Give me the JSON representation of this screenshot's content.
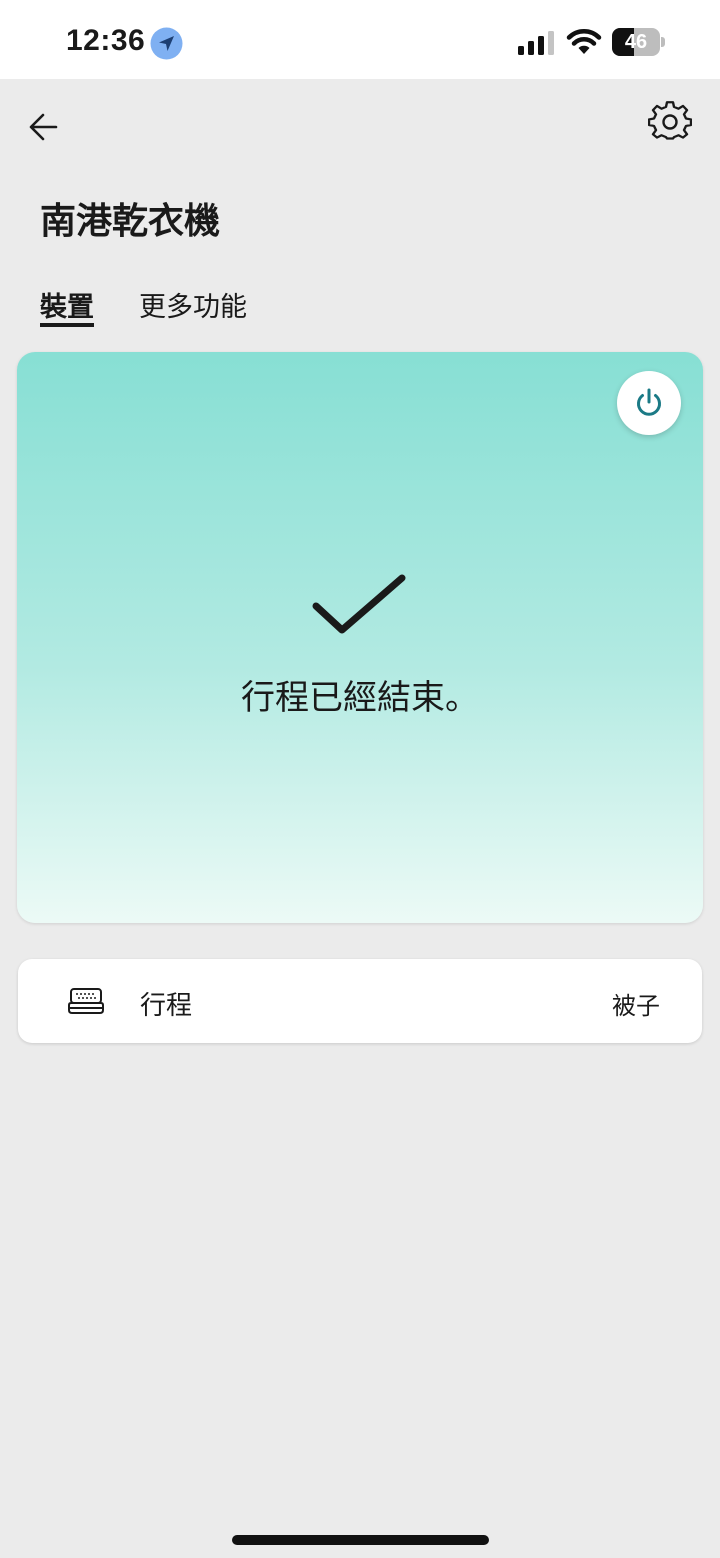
{
  "status_bar": {
    "time": "12:36",
    "battery_percent": 46,
    "battery_label": "46"
  },
  "header": {
    "title": "南港乾衣機"
  },
  "tabs": [
    {
      "label": "裝置",
      "active": true
    },
    {
      "label": "更多功能",
      "active": false
    }
  ],
  "status_card": {
    "message": "行程已經結束。",
    "gradient_top": "#87dfd4",
    "gradient_bottom": "#ecfaf6"
  },
  "cycle_setting": {
    "label": "行程",
    "value": "被子"
  },
  "colors": {
    "power_icon": "#1b7a86",
    "background": "#ebebeb"
  },
  "icons": {
    "back": "arrow-left-icon",
    "settings": "gear-icon",
    "power": "power-icon",
    "check": "checkmark-icon",
    "cycle": "laundry-icon"
  }
}
